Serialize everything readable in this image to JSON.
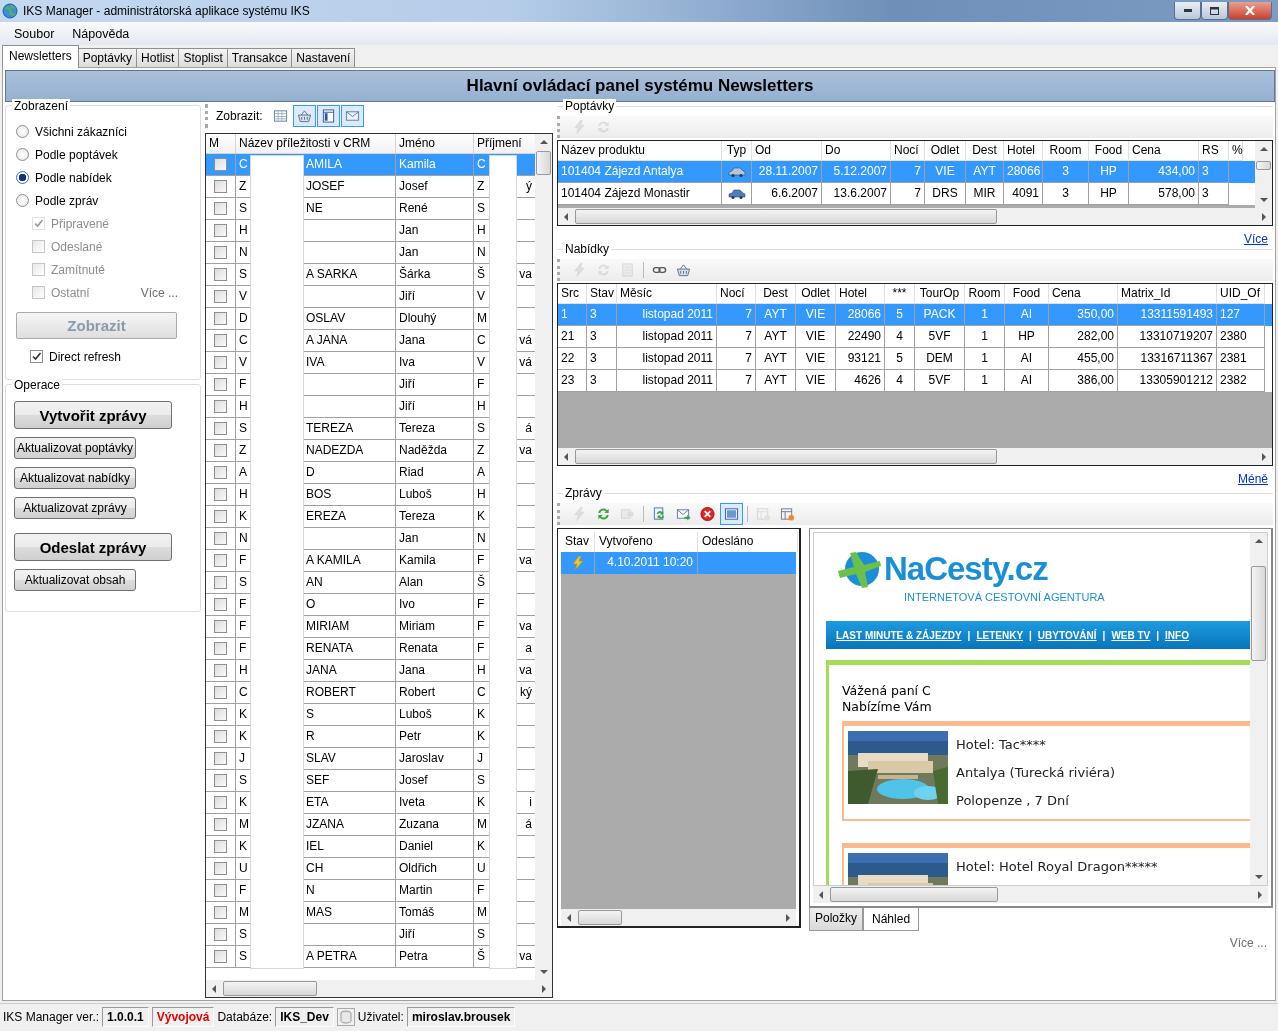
{
  "window": {
    "title": "IKS Manager - administrátorská aplikace systému IKS"
  },
  "menu": [
    "Soubor",
    "Nápověda"
  ],
  "tabs": [
    {
      "label": "Newsletters",
      "selected": true
    },
    {
      "label": "Poptávky",
      "selected": false
    },
    {
      "label": "Hotlist",
      "selected": false
    },
    {
      "label": "Stoplist",
      "selected": false
    },
    {
      "label": "Transakce",
      "selected": false
    },
    {
      "label": "Nastavení",
      "selected": false
    }
  ],
  "header": "Hlavní ovládací panel systému Newsletters",
  "display": {
    "title": "Zobrazení",
    "options": [
      {
        "label": "Všichni zákazníci",
        "selected": false
      },
      {
        "label": "Podle poptávek",
        "selected": false
      },
      {
        "label": "Podle nabídek",
        "selected": true
      },
      {
        "label": "Podle zpráv",
        "selected": false
      }
    ],
    "filters": [
      {
        "label": "Připravené",
        "checked": true,
        "disabled": true
      },
      {
        "label": "Odeslané",
        "checked": false,
        "disabled": true
      },
      {
        "label": "Zamítnuté",
        "checked": false,
        "disabled": true
      },
      {
        "label": "Ostatní",
        "checked": false,
        "disabled": true
      }
    ],
    "more": "Více ...",
    "show_button": {
      "label": "Zobrazit",
      "disabled": true
    },
    "direct_refresh": {
      "label": "Direct refresh",
      "checked": true
    }
  },
  "operations": {
    "title": "Operace",
    "buttons": [
      {
        "label": "Vytvořit zprávy",
        "kind": "large"
      },
      {
        "label": "Aktualizovat poptávky",
        "kind": "small"
      },
      {
        "label": "Aktualizovat nabídky",
        "kind": "small"
      },
      {
        "label": "Aktualizovat zprávy",
        "kind": "small"
      },
      {
        "label": "Odeslat zprávy",
        "kind": "large"
      },
      {
        "label": "Aktualizovat obsah",
        "kind": "small"
      }
    ]
  },
  "customers": {
    "toolbar_label": "Zobrazit:",
    "toolbar": [
      {
        "pressed": false
      },
      {
        "pressed": true
      },
      {
        "pressed": true
      },
      {
        "pressed": true
      }
    ],
    "columns": [
      "M",
      "Název příležitosti v CRM",
      "Jméno",
      "Příjmení"
    ],
    "rows": [
      {
        "checked": false,
        "selected": true,
        "name_start": "C",
        "name_end": "AMILA",
        "first_name": "Kamila",
        "surname_start": "C"
      },
      {
        "checked": false,
        "selected": false,
        "name_start": "Z",
        "name_end": "JOSEF",
        "first_name": "Josef",
        "surname_start": "Z",
        "surname_end": "ý"
      },
      {
        "checked": false,
        "selected": false,
        "name_start": "S",
        "name_end": "NE",
        "first_name": "René",
        "surname_start": "S"
      },
      {
        "checked": false,
        "selected": false,
        "name_start": "H",
        "first_name": "Jan",
        "surname_start": "H"
      },
      {
        "checked": false,
        "selected": false,
        "name_start": "N",
        "first_name": "Jan",
        "surname_start": "N"
      },
      {
        "checked": false,
        "selected": false,
        "name_start": "S",
        "name_end": "A SARKA",
        "first_name": "Šárka",
        "surname_start": "Š",
        "surname_end": "va"
      },
      {
        "checked": false,
        "selected": false,
        "name_start": "V",
        "first_name": "Jiří",
        "surname_start": "V"
      },
      {
        "checked": false,
        "selected": false,
        "name_start": "D",
        "name_end": "OSLAV",
        "first_name": "Dlouhý",
        "surname_start": "M"
      },
      {
        "checked": false,
        "selected": false,
        "name_start": "C",
        "name_end": "A JANA",
        "first_name": "Jana",
        "surname_start": "C",
        "surname_end": "vá"
      },
      {
        "checked": false,
        "selected": false,
        "name_start": "V",
        "name_end": "IVA",
        "first_name": "Iva",
        "surname_start": "V",
        "surname_end": "vá"
      },
      {
        "checked": false,
        "selected": false,
        "name_start": "F",
        "first_name": "Jiří",
        "surname_start": "F"
      },
      {
        "checked": false,
        "selected": false,
        "name_start": "H",
        "first_name": "Jiří",
        "surname_start": "H"
      },
      {
        "checked": false,
        "selected": false,
        "name_start": "S",
        "name_end": "TEREZA",
        "first_name": "Tereza",
        "surname_start": "S",
        "surname_end": "á"
      },
      {
        "checked": false,
        "selected": false,
        "name_start": "Z",
        "name_end": "NADEZDA",
        "first_name": "Naděžda",
        "surname_start": "Z",
        "surname_end": "va"
      },
      {
        "checked": false,
        "selected": false,
        "name_start": "A",
        "name_end": "D",
        "first_name": "Riad",
        "surname_start": "A"
      },
      {
        "checked": false,
        "selected": false,
        "name_start": "H",
        "name_end": "BOS",
        "first_name": "Luboš",
        "surname_start": "H"
      },
      {
        "checked": false,
        "selected": false,
        "name_start": "K",
        "name_end": "EREZA",
        "first_name": "Tereza",
        "surname_start": "K"
      },
      {
        "checked": false,
        "selected": false,
        "name_start": "N",
        "first_name": "Jan",
        "surname_start": "N"
      },
      {
        "checked": false,
        "selected": false,
        "name_start": "F",
        "name_end": "A KAMILA",
        "first_name": "Kamila",
        "surname_start": "F",
        "surname_end": "va"
      },
      {
        "checked": false,
        "selected": false,
        "name_start": "S",
        "name_end": "AN",
        "first_name": "Alan",
        "surname_start": "Š"
      },
      {
        "checked": false,
        "selected": false,
        "name_start": "F",
        "name_end": "O",
        "first_name": "Ivo",
        "surname_start": "F"
      },
      {
        "checked": false,
        "selected": false,
        "name_start": "F",
        "name_end": "MIRIAM",
        "first_name": "Miriam",
        "surname_start": "F",
        "surname_end": "va"
      },
      {
        "checked": false,
        "selected": false,
        "name_start": "F",
        "name_end": "RENATA",
        "first_name": "Renata",
        "surname_start": "F",
        "surname_end": "a"
      },
      {
        "checked": false,
        "selected": false,
        "name_start": "H",
        "name_end": "JANA",
        "first_name": "Jana",
        "surname_start": "H",
        "surname_end": "va"
      },
      {
        "checked": false,
        "selected": false,
        "name_start": "C",
        "name_end": "ROBERT",
        "first_name": "Robert",
        "surname_start": "C",
        "surname_end": "ký"
      },
      {
        "checked": false,
        "selected": false,
        "name_start": "K",
        "name_end": "S",
        "first_name": "Luboš",
        "surname_start": "K"
      },
      {
        "checked": false,
        "selected": false,
        "name_start": "K",
        "name_end": "R",
        "first_name": "Petr",
        "surname_start": "K"
      },
      {
        "checked": false,
        "selected": false,
        "name_start": "J",
        "name_end": "SLAV",
        "first_name": "Jaroslav",
        "surname_start": "J"
      },
      {
        "checked": false,
        "selected": false,
        "name_start": "S",
        "name_end": "SEF",
        "first_name": "Josef",
        "surname_start": "S"
      },
      {
        "checked": false,
        "selected": false,
        "name_start": "K",
        "name_end": "ETA",
        "first_name": "Iveta",
        "surname_start": "K",
        "surname_end": "i"
      },
      {
        "checked": false,
        "selected": false,
        "name_start": "M",
        "name_end": "JZANA",
        "first_name": "Zuzana",
        "surname_start": "M",
        "surname_end": "á"
      },
      {
        "checked": false,
        "selected": false,
        "name_start": "K",
        "name_end": "IEL",
        "first_name": "Daniel",
        "surname_start": "K"
      },
      {
        "checked": false,
        "selected": false,
        "name_start": "U",
        "name_end": "CH",
        "first_name": "Oldřich",
        "surname_start": "U"
      },
      {
        "checked": false,
        "selected": false,
        "name_start": "F",
        "name_end": "N",
        "first_name": "Martin",
        "surname_start": "F"
      },
      {
        "checked": false,
        "selected": false,
        "name_start": "M",
        "name_end": "MAS",
        "first_name": "Tomáš",
        "surname_start": "M"
      },
      {
        "checked": false,
        "selected": false,
        "name_start": "S",
        "first_name": "Jiří",
        "surname_start": "S"
      },
      {
        "checked": false,
        "selected": false,
        "name_start": "S",
        "name_end": "A PETRA",
        "first_name": "Petra",
        "surname_start": "Š",
        "surname_end": "va"
      }
    ]
  },
  "inquiries": {
    "title": "Poptávky",
    "toolbar": [
      {
        "disabled": true,
        "pressed": false
      },
      {
        "disabled": true,
        "pressed": false
      }
    ],
    "columns": [
      {
        "label": "Název produktu",
        "kind": "text"
      },
      {
        "label": "Typ",
        "kind": "icon"
      },
      {
        "label": "Od",
        "kind": "number"
      },
      {
        "label": "Do",
        "kind": "number"
      },
      {
        "label": "Nocí",
        "kind": "number"
      },
      {
        "label": "Odlet",
        "kind": "center"
      },
      {
        "label": "Dest",
        "kind": "center"
      },
      {
        "label": "Hotel",
        "kind": "number"
      },
      {
        "label": "Room",
        "kind": "center"
      },
      {
        "label": "Food",
        "kind": "center"
      },
      {
        "label": "Cena",
        "kind": "number"
      },
      {
        "label": "RS",
        "kind": "text"
      },
      {
        "label": "%",
        "kind": "text"
      }
    ],
    "rows": [
      {
        "selected": true,
        "cells": [
          "101404 Zájezd Antalya",
          "",
          "28.11.2007",
          "5.12.2007",
          "7",
          "VIE",
          "AYT",
          "28066",
          "3",
          "HP",
          "434,00",
          "3"
        ]
      },
      {
        "selected": false,
        "cells": [
          "101404 Zájezd Monastir",
          "",
          "6.6.2007",
          "13.6.2007",
          "7",
          "DRS",
          "MIR",
          "4091",
          "3",
          "HP",
          "578,00",
          "3"
        ]
      }
    ],
    "link": "Více"
  },
  "offers": {
    "title": "Nabídky",
    "toolbar": [
      {
        "disabled": true,
        "pressed": false
      },
      {
        "disabled": true,
        "pressed": false
      },
      {
        "disabled": true,
        "pressed": false
      },
      {
        "disabled": false,
        "pressed": false
      },
      {
        "disabled": false,
        "pressed": false
      }
    ],
    "columns": [
      {
        "label": "Src",
        "kind": "text"
      },
      {
        "label": "Stav",
        "kind": "text"
      },
      {
        "label": "Měsíc",
        "kind": "number"
      },
      {
        "label": "Nocí",
        "kind": "number"
      },
      {
        "label": "Dest",
        "kind": "center"
      },
      {
        "label": "Odlet",
        "kind": "center"
      },
      {
        "label": "Hotel",
        "kind": "number"
      },
      {
        "label": "***",
        "kind": "center"
      },
      {
        "label": "TourOp",
        "kind": "center"
      },
      {
        "label": "Room",
        "kind": "center"
      },
      {
        "label": "Food",
        "kind": "center"
      },
      {
        "label": "Cena",
        "kind": "number"
      },
      {
        "label": "Matrix_Id",
        "kind": "number"
      },
      {
        "label": "UID_Of",
        "kind": "text"
      }
    ],
    "rows": [
      {
        "selected": true,
        "cells": [
          "1",
          "3",
          "listopad 2011",
          "7",
          "AYT",
          "VIE",
          "28066",
          "5",
          "PACK",
          "1",
          "AI",
          "350,00",
          "13311591493",
          "127"
        ]
      },
      {
        "selected": false,
        "cells": [
          "21",
          "3",
          "listopad 2011",
          "7",
          "AYT",
          "VIE",
          "22490",
          "4",
          "5VF",
          "1",
          "HP",
          "282,00",
          "13310719207",
          "2380"
        ]
      },
      {
        "selected": false,
        "cells": [
          "22",
          "3",
          "listopad 2011",
          "7",
          "AYT",
          "VIE",
          "93121",
          "5",
          "DEM",
          "1",
          "AI",
          "455,00",
          "13316711367",
          "2381"
        ]
      },
      {
        "selected": false,
        "cells": [
          "23",
          "3",
          "listopad 2011",
          "7",
          "AYT",
          "VIE",
          "4626",
          "4",
          "5VF",
          "1",
          "AI",
          "386,00",
          "13305901212",
          "2382"
        ]
      }
    ],
    "link": "Méně"
  },
  "messages": {
    "title": "Zprávy",
    "toolbar": [
      {
        "disabled": true,
        "pressed": false
      },
      {
        "disabled": false,
        "pressed": false
      },
      {
        "disabled": true,
        "pressed": false
      },
      {
        "disabled": false,
        "pressed": false
      },
      {
        "disabled": false,
        "pressed": false
      },
      {
        "disabled": false,
        "pressed": false
      },
      {
        "disabled": false,
        "pressed": true
      },
      {
        "disabled": true,
        "pressed": false
      },
      {
        "disabled": false,
        "pressed": false
      }
    ],
    "columns": [
      "Stav",
      "Vytvořeno",
      "Odesláno"
    ],
    "rows": [
      {
        "selected": true,
        "created": "4.10.2011 10:20"
      }
    ],
    "preview": {
      "logo": "NaCesty.cz",
      "tagline": "INTERNETOVÁ CESTOVNÍ AGENTURA",
      "nav": [
        {
          "kind": "link",
          "text": "LAST MINUTE & ZÁJEZDY"
        },
        {
          "kind": "separator",
          "text": "|"
        },
        {
          "kind": "link",
          "text": "LETENKY"
        },
        {
          "kind": "separator",
          "text": "|"
        },
        {
          "kind": "link",
          "text": "UBYTOVÁNÍ"
        },
        {
          "kind": "separator",
          "text": "|"
        },
        {
          "kind": "link",
          "text": "WEB TV"
        },
        {
          "kind": "separator",
          "text": "|"
        },
        {
          "kind": "link",
          "text": "INFO"
        }
      ],
      "greeting": [
        "Vážená paní C",
        "Nabízíme Vám"
      ],
      "hotels": [
        {
          "lines": [
            "Hotel: Tac****",
            "Antalya (Turecká riviéra)",
            "Polopenze , 7 Dní"
          ]
        },
        {
          "lines": [
            "Hotel: Hotel Royal Dragon*****"
          ]
        }
      ]
    },
    "preview_tabs": [
      {
        "label": "Položky",
        "selected": false
      },
      {
        "label": "Náhled",
        "selected": true
      }
    ],
    "more": "Více ..."
  },
  "status_bar": [
    {
      "kind": "label",
      "text": "IKS Manager ver.:"
    },
    {
      "kind": "value",
      "text": "1.0.0.1"
    },
    {
      "kind": "warning",
      "text": "Vývojová"
    },
    {
      "kind": "label",
      "text": "Databáze:"
    },
    {
      "kind": "value",
      "text": "IKS_Dev"
    },
    {
      "kind": "db_icon"
    },
    {
      "kind": "label",
      "text": "Uživatel:"
    },
    {
      "kind": "value",
      "text": "miroslav.brousek"
    }
  ]
}
